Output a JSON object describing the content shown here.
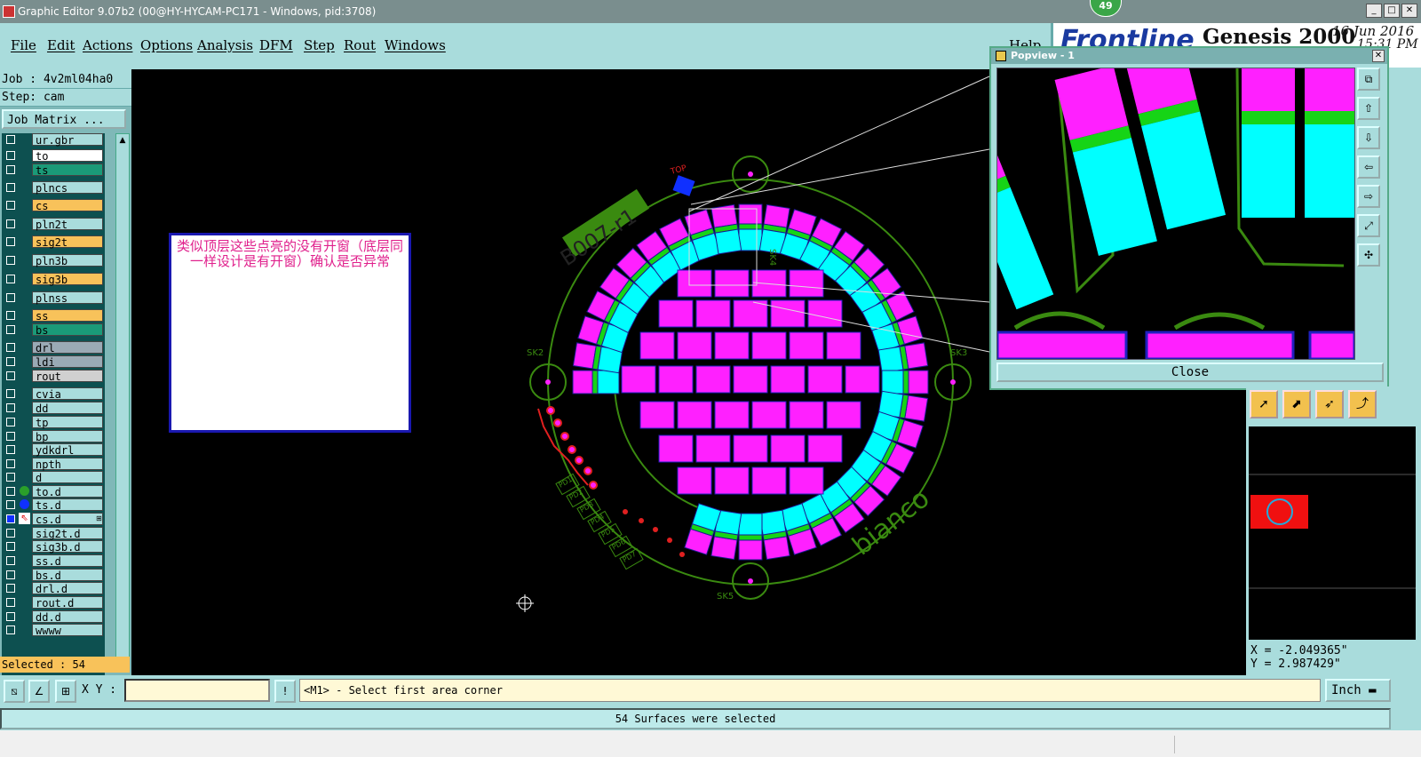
{
  "window": {
    "title": "Graphic Editor 9.07b2 (00@HY-HYCAM-PC171 - Windows, pid:3708)",
    "min": "_",
    "max": "□",
    "close": "✕"
  },
  "notification_badge": "49",
  "menu": [
    {
      "label": "File"
    },
    {
      "label": "Edit"
    },
    {
      "label": "Actions"
    },
    {
      "label": "Options"
    },
    {
      "label": "Analysis"
    },
    {
      "label": "DFM"
    },
    {
      "label": "Step"
    },
    {
      "label": "Rout"
    },
    {
      "label": "Windows"
    }
  ],
  "help_label": "Help",
  "brand": {
    "logo": "Frontline",
    "product": "Genesis 2000",
    "date": "16 Jun 2016",
    "time": "15:31 PM"
  },
  "job": {
    "job_label": "Job : 4v2ml04ha0",
    "step_label": "Step: cam",
    "matrix_button": "Job Matrix ..."
  },
  "layers": [
    {
      "name": "ur.gbr",
      "color": "#a9dcdc"
    },
    {
      "name": "to",
      "color": "#ffffff"
    },
    {
      "name": "ts",
      "color": "#1a9a78"
    },
    {
      "name": "plncs",
      "color": "#a9dcdc"
    },
    {
      "name": "cs",
      "color": "#f8c25a"
    },
    {
      "name": "pln2t",
      "color": "#a9dcdc"
    },
    {
      "name": "sig2t",
      "color": "#f8c25a"
    },
    {
      "name": "pln3b",
      "color": "#a9dcdc"
    },
    {
      "name": "sig3b",
      "color": "#f8c25a"
    },
    {
      "name": "plnss",
      "color": "#a9dcdc"
    },
    {
      "name": "ss",
      "color": "#f8c25a"
    },
    {
      "name": "bs",
      "color": "#1a9a78"
    },
    {
      "name": "drl",
      "color": "#9aaab5"
    },
    {
      "name": "ldi",
      "color": "#9aaab5"
    },
    {
      "name": "rout",
      "color": "#d0d0d0"
    },
    {
      "name": "cvia",
      "color": "#a9dcdc"
    },
    {
      "name": "dd",
      "color": "#a9dcdc"
    },
    {
      "name": "tp",
      "color": "#a9dcdc"
    },
    {
      "name": "bp",
      "color": "#a9dcdc"
    },
    {
      "name": "ydkdrl",
      "color": "#a9dcdc"
    },
    {
      "name": "npth",
      "color": "#a9dcdc"
    },
    {
      "name": "d",
      "color": "#a9dcdc"
    },
    {
      "name": "to.d",
      "color": "#a9dcdc"
    },
    {
      "name": "ts.d",
      "color": "#a9dcdc"
    },
    {
      "name": "cs.d",
      "color": "#a9dcdc"
    },
    {
      "name": "sig2t.d",
      "color": "#a9dcdc"
    },
    {
      "name": "sig3b.d",
      "color": "#a9dcdc"
    },
    {
      "name": "ss.d",
      "color": "#a9dcdc"
    },
    {
      "name": "bs.d",
      "color": "#a9dcdc"
    },
    {
      "name": "drl.d",
      "color": "#a9dcdc"
    },
    {
      "name": "rout.d",
      "color": "#a9dcdc"
    },
    {
      "name": "dd.d",
      "color": "#a9dcdc"
    },
    {
      "name": "wwww",
      "color": "#a9dcdc"
    }
  ],
  "selected_status": "Selected : 54",
  "note": "类似顶层这些点亮的没有开窗（底层同一样设计是有开窗）确认是否异常",
  "board": {
    "ref": "B007-r1",
    "top_label": "TOP",
    "brand_text": "bianco",
    "holes": [
      "SK4",
      "SK2",
      "SK3",
      "SK5"
    ],
    "pads": [
      "PD1",
      "PD2",
      "PD3",
      "PD4",
      "PD5",
      "PD6",
      "PD7"
    ]
  },
  "popview": {
    "title": "Popview - 1",
    "close_label": "Close"
  },
  "coords": {
    "x": "X = -2.049365\"",
    "y": "Y = 2.987429\""
  },
  "xy_label": "X Y :",
  "xy_value": "",
  "prompt_text": "<M1> - Select first area corner",
  "unit": "Inch",
  "status_message": "54 Surfaces were selected",
  "colors": {
    "magenta": "#ff20ff",
    "cyan": "#00ffff",
    "green": "#16d416",
    "outline": "#3a8a10",
    "accent": "#f2c14e"
  }
}
